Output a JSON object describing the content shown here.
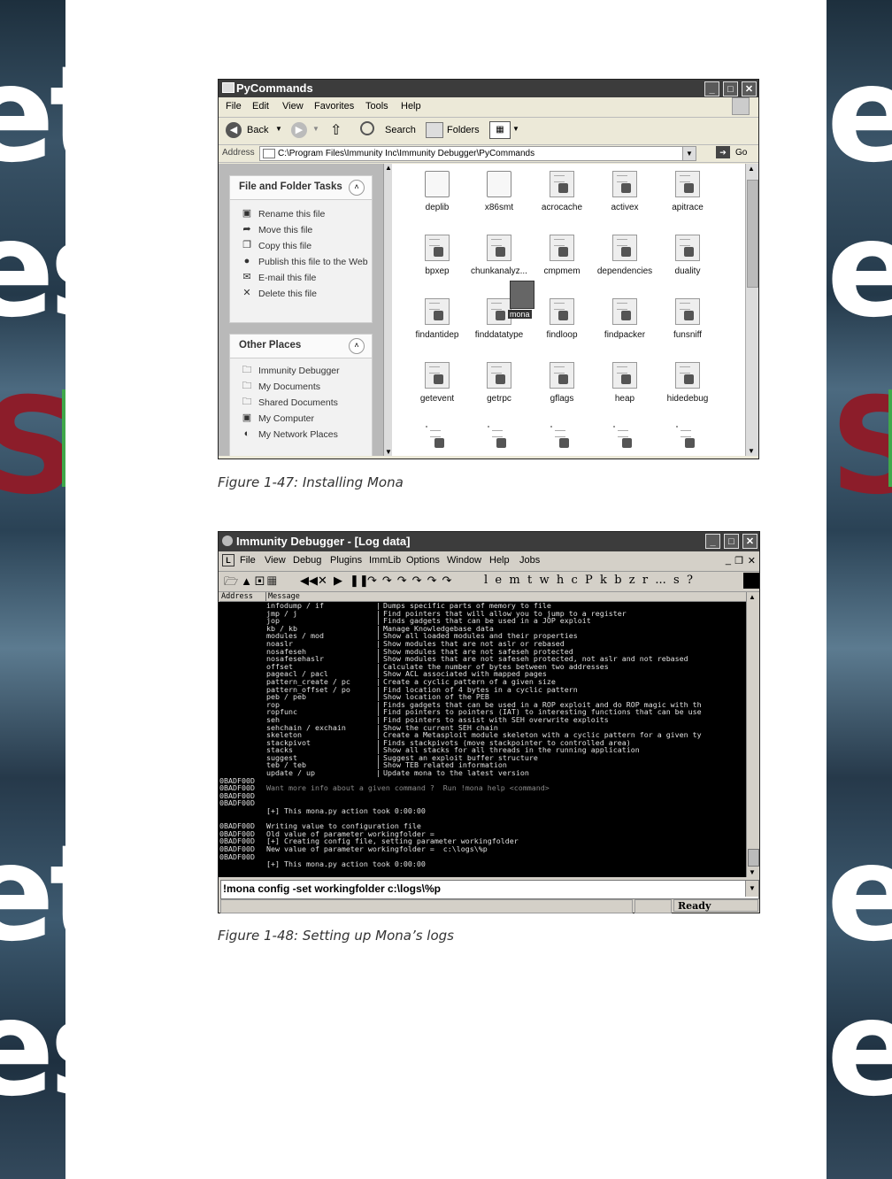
{
  "figure1": {
    "window_title": "PyCommands",
    "menu": [
      "File",
      "Edit",
      "View",
      "Favorites",
      "Tools",
      "Help"
    ],
    "toolbar": {
      "back": "Back",
      "search": "Search",
      "folders": "Folders"
    },
    "address_label": "Address",
    "address_value": "C:\\Program Files\\Immunity Inc\\Immunity Debugger\\PyCommands",
    "go_label": "Go",
    "tasks_panel": {
      "title": "File and Folder Tasks",
      "items": [
        "Rename this file",
        "Move this file",
        "Copy this file",
        "Publish this file to the Web",
        "E-mail this file",
        "Delete this file"
      ]
    },
    "places_panel": {
      "title": "Other Places",
      "items": [
        "Immunity Debugger",
        "My Documents",
        "Shared Documents",
        "My Computer",
        "My Network Places"
      ]
    },
    "files": [
      "deplib",
      "x86smt",
      "acrocache",
      "activex",
      "apitrace",
      "bpxep",
      "chunkanalyz...",
      "cmpmem",
      "dependencies",
      "duality",
      "findantidep",
      "finddatatype",
      "findloop",
      "findpacker",
      "funsniff",
      "getevent",
      "getrpc",
      "gflags",
      "heap",
      "hidedebug"
    ],
    "drag_label": "mona",
    "caption": "Figure 1-47: Installing Mona"
  },
  "figure2": {
    "window_title": "Immunity Debugger - [Log data]",
    "menu": [
      "File",
      "View",
      "Debug",
      "Plugins",
      "ImmLib",
      "Options",
      "Window",
      "Help",
      "Jobs"
    ],
    "toolbar_letters": "l  e  m  t  w  h  c  P  k  b  z  r  ...  s  ?",
    "headers": {
      "address": "Address",
      "message": "Message"
    },
    "log_rows": [
      {
        "addr": "",
        "cmd": "infodump / if",
        "desc": "Dumps specific parts of memory to file"
      },
      {
        "addr": "",
        "cmd": "jmp / j",
        "desc": "Find pointers that will allow you to jump to a register"
      },
      {
        "addr": "",
        "cmd": "jop",
        "desc": "Finds gadgets that can be used in a JOP exploit"
      },
      {
        "addr": "",
        "cmd": "kb / kb",
        "desc": "Manage Knowledgebase data"
      },
      {
        "addr": "",
        "cmd": "modules / mod",
        "desc": "Show all loaded modules and their properties"
      },
      {
        "addr": "",
        "cmd": "noaslr",
        "desc": "Show modules that are not aslr or rebased"
      },
      {
        "addr": "",
        "cmd": "nosafeseh",
        "desc": "Show modules that are not safeseh protected"
      },
      {
        "addr": "",
        "cmd": "nosafesehaslr",
        "desc": "Show modules that are not safeseh protected, not aslr and not rebased"
      },
      {
        "addr": "",
        "cmd": "offset",
        "desc": "Calculate the number of bytes between two addresses"
      },
      {
        "addr": "",
        "cmd": "pageacl / pacl",
        "desc": "Show ACL associated with mapped pages"
      },
      {
        "addr": "",
        "cmd": "pattern_create / pc",
        "desc": "Create a cyclic pattern of a given size"
      },
      {
        "addr": "",
        "cmd": "pattern_offset / po",
        "desc": "Find location of 4 bytes in a cyclic pattern"
      },
      {
        "addr": "",
        "cmd": "peb / peb",
        "desc": "Show location of the PEB"
      },
      {
        "addr": "",
        "cmd": "rop",
        "desc": "Finds gadgets that can be used in a ROP exploit and do ROP magic with th"
      },
      {
        "addr": "",
        "cmd": "ropfunc",
        "desc": "Find pointers to pointers (IAT) to interesting functions that can be use"
      },
      {
        "addr": "",
        "cmd": "seh",
        "desc": "Find pointers to assist with SEH overwrite exploits"
      },
      {
        "addr": "",
        "cmd": "sehchain / exchain",
        "desc": "Show the current SEH chain"
      },
      {
        "addr": "",
        "cmd": "skeleton",
        "desc": "Create a Metasploit module skeleton with a cyclic pattern for a given ty"
      },
      {
        "addr": "",
        "cmd": "stackpivot",
        "desc": "Finds stackpivots (move stackpointer to controlled area)"
      },
      {
        "addr": "",
        "cmd": "stacks",
        "desc": "Show all stacks for all threads in the running application"
      },
      {
        "addr": "",
        "cmd": "suggest",
        "desc": "Suggest an exploit buffer structure"
      },
      {
        "addr": "",
        "cmd": "teb / teb",
        "desc": "Show TEB related information"
      },
      {
        "addr": "",
        "cmd": "update / up",
        "desc": "Update mona to the latest version"
      }
    ],
    "tail_rows": [
      {
        "addr": "0BADF00D",
        "text": ""
      },
      {
        "addr": "0BADF00D",
        "text": "Want more info about a given command ?  Run !mona help <command>"
      },
      {
        "addr": "0BADF00D",
        "text": ""
      },
      {
        "addr": "0BADF00D",
        "text": ""
      },
      {
        "addr": "",
        "text": "[+] This mona.py action took 0:00:00"
      },
      {
        "addr": "",
        "text": ""
      },
      {
        "addr": "0BADF00D",
        "text": "Writing value to configuration file"
      },
      {
        "addr": "0BADF00D",
        "text": "Old value of parameter workingfolder ="
      },
      {
        "addr": "0BADF00D",
        "text": "[+] Creating config file, setting parameter workingfolder"
      },
      {
        "addr": "0BADF00D",
        "text": "New value of parameter workingfolder =  c:\\logs\\%p"
      },
      {
        "addr": "0BADF00D",
        "text": ""
      },
      {
        "addr": "",
        "text": "[+] This mona.py action took 0:00:00"
      }
    ],
    "command_input": "!mona config -set workingfolder c:\\logs\\%p",
    "status": "Ready",
    "caption": "Figure 1-48: Setting up Mona’s logs"
  }
}
